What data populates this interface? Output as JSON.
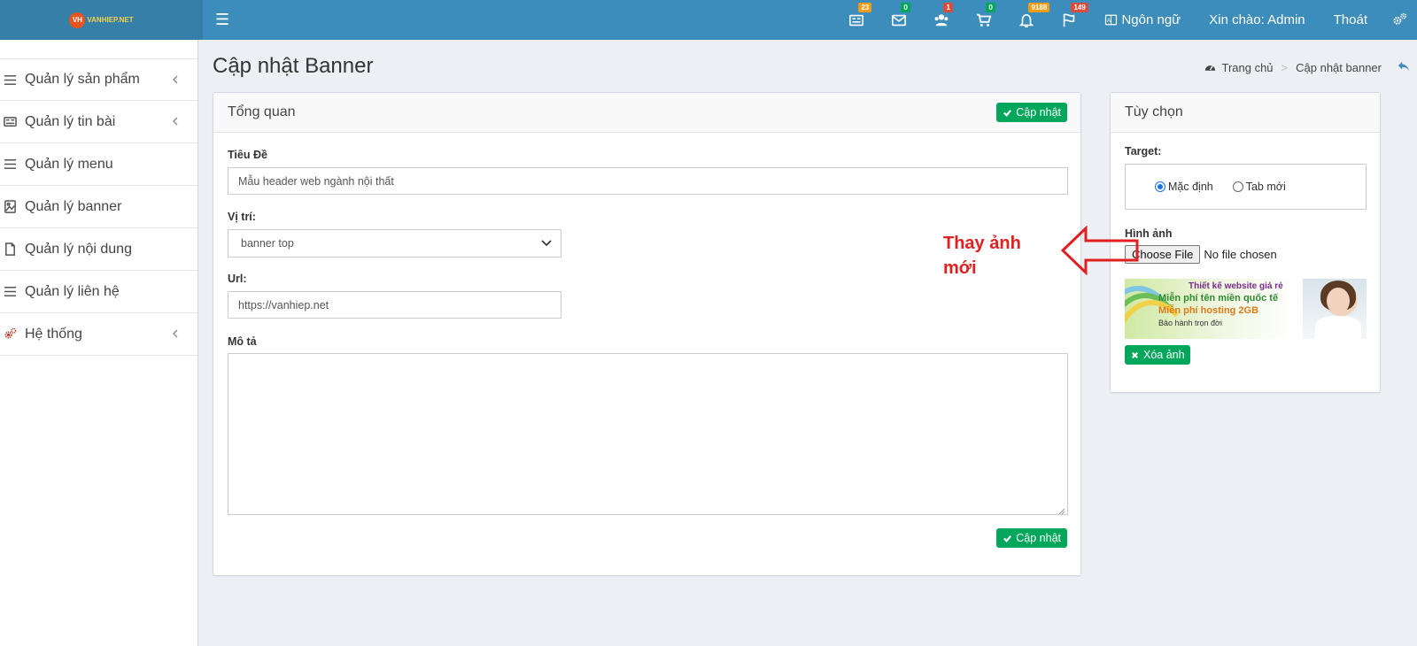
{
  "app": {
    "logo_text": "VANHIEP.NET",
    "logo_badge": "VH"
  },
  "topbar": {
    "menu_icon": "hamburger-icon",
    "badges": [
      {
        "icon": "newspaper-icon",
        "count": "23",
        "color": "#f39c12"
      },
      {
        "icon": "envelope-icon",
        "count": "0",
        "color": "#00a65a"
      },
      {
        "icon": "users-icon",
        "count": "1",
        "color": "#dd4b39"
      },
      {
        "icon": "cart-icon",
        "count": "0",
        "color": "#00a65a"
      },
      {
        "icon": "bell-icon",
        "count": "9188",
        "color": "#f39c12"
      },
      {
        "icon": "flag-icon",
        "count": "149",
        "color": "#dd4b39"
      }
    ],
    "language_label": "Ngôn ngữ",
    "greeting": "Xin chào: Admin",
    "logout_label": "Thoát"
  },
  "sidebar": {
    "items": [
      {
        "label": "Quản lý sản phẩm",
        "icon": "list-icon",
        "has_children": true
      },
      {
        "label": "Quản lý tin bài",
        "icon": "newspaper-icon",
        "has_children": true
      },
      {
        "label": "Quản lý menu",
        "icon": "list-icon",
        "has_children": false
      },
      {
        "label": "Quản lý banner",
        "icon": "image-icon",
        "has_children": false
      },
      {
        "label": "Quản lý nội dung",
        "icon": "file-icon",
        "has_children": false
      },
      {
        "label": "Quản lý liên hệ",
        "icon": "list-icon",
        "has_children": false
      },
      {
        "label": "Hệ thống",
        "icon": "gears-icon",
        "has_children": true
      }
    ]
  },
  "page": {
    "title": "Cập nhật Banner",
    "breadcrumb": {
      "home": "Trang chủ",
      "current": "Cập nhật banner"
    }
  },
  "overview": {
    "title": "Tổng quan",
    "update_label": "Cập nhật",
    "title_label": "Tiêu Đề",
    "title_value": "Mẫu header web ngành nội thất",
    "position_label": "Vị trí:",
    "position_value": "banner top",
    "url_label": "Url:",
    "url_value": "https://vanhiep.net",
    "desc_label": "Mô tả",
    "desc_value": "",
    "bottom_update_label": "Cập nhật"
  },
  "options": {
    "title": "Tùy chọn",
    "target_label": "Target:",
    "radio_default": "Mặc định",
    "radio_new_tab": "Tab mới",
    "selected": "default",
    "image_label": "Hình ảnh",
    "choose_file": "Choose File",
    "no_file": "No file chosen",
    "delete_image": "Xóa ảnh",
    "banner": {
      "line1": "Thiết kế website giá rẻ",
      "line2": "Miễn phí tên miền quốc tế",
      "line3": "Miễn phí hosting 2GB",
      "line4": "Bảo hành trọn đời"
    }
  },
  "annotation": {
    "text": "Thay ảnh mới",
    "color": "#e02020"
  }
}
